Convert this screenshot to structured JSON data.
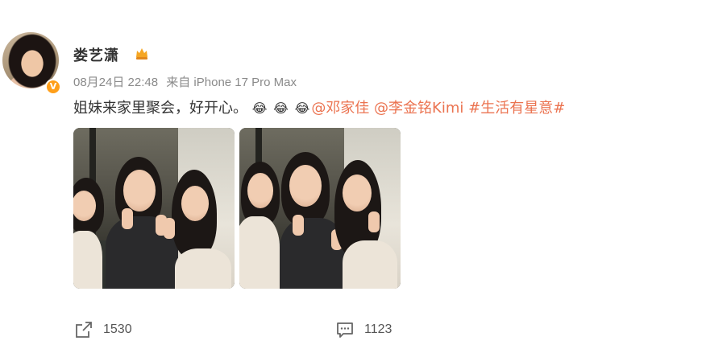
{
  "post": {
    "username": "娄艺潇",
    "user_badge_icon": "fire-crown-icon",
    "verified_badge": "V",
    "timestamp": "08月24日 22:48",
    "source": "来自 iPhone 17 Pro Max",
    "text": {
      "body": "姐妹来家里聚会，好开心。",
      "emojis": [
        "😂",
        "😂",
        "😂"
      ],
      "mention_1": "@邓家佳",
      "mention_2": "@李金铭Kimi",
      "hashtag": "#生活有星意#"
    },
    "photos_count": 2
  },
  "footer": {
    "share_count": "1530",
    "comment_count": "1123"
  },
  "colors": {
    "link": "#eb7350",
    "meta": "#8a8a8a",
    "badge": "#ff9f1a"
  }
}
